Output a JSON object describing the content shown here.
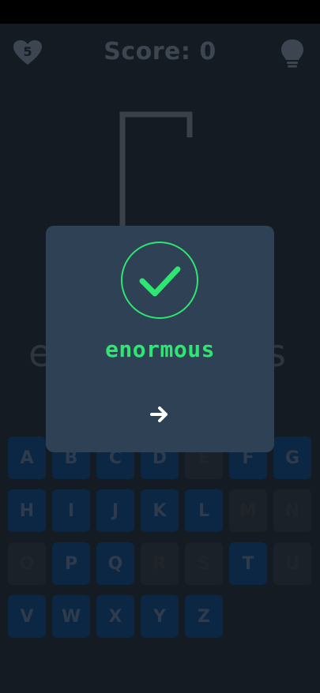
{
  "header": {
    "lives": "5",
    "score_label": "Score: 0"
  },
  "word_partial": {
    "left": "e",
    "right": "s"
  },
  "keyboard": {
    "keys": [
      {
        "letter": "A",
        "used": false
      },
      {
        "letter": "B",
        "used": false
      },
      {
        "letter": "C",
        "used": false
      },
      {
        "letter": "D",
        "used": false
      },
      {
        "letter": "E",
        "used": true
      },
      {
        "letter": "F",
        "used": false
      },
      {
        "letter": "G",
        "used": false
      },
      {
        "letter": "H",
        "used": false
      },
      {
        "letter": "I",
        "used": false
      },
      {
        "letter": "J",
        "used": false
      },
      {
        "letter": "K",
        "used": false
      },
      {
        "letter": "L",
        "used": false
      },
      {
        "letter": "M",
        "used": true
      },
      {
        "letter": "N",
        "used": true
      },
      {
        "letter": "O",
        "used": true
      },
      {
        "letter": "P",
        "used": false
      },
      {
        "letter": "Q",
        "used": false
      },
      {
        "letter": "R",
        "used": true
      },
      {
        "letter": "S",
        "used": true
      },
      {
        "letter": "T",
        "used": false
      },
      {
        "letter": "U",
        "used": true
      },
      {
        "letter": "V",
        "used": false
      },
      {
        "letter": "W",
        "used": false
      },
      {
        "letter": "X",
        "used": false
      },
      {
        "letter": "Y",
        "used": false
      },
      {
        "letter": "Z",
        "used": false
      }
    ]
  },
  "modal": {
    "answer": "enormous",
    "icon": "check-icon",
    "next_icon": "arrow-right-icon"
  },
  "colors": {
    "accent_green": "#2ee672",
    "modal_bg": "#2f4154",
    "key_unused": "#0c2744",
    "key_used": "#1b2128"
  }
}
